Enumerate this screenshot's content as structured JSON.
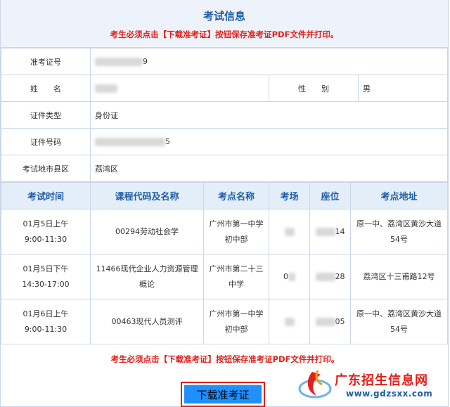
{
  "header": {
    "title": "考试信息",
    "notice": "考生必须点击【下载准考证】按钮保存准考证PDF文件并打印。"
  },
  "candidate": {
    "admission_no_label": "准考证号",
    "admission_no_suffix": "9",
    "name_label": "姓　　名",
    "gender_label": "性　　别",
    "gender_value": "男",
    "id_type_label": "证件类型",
    "id_type_value": "身份证",
    "id_no_label": "证件号码",
    "id_no_suffix": "5",
    "region_label": "考试地市县区",
    "region_value": "荔湾区"
  },
  "exam_table": {
    "headers": [
      "考试时间",
      "课程代码及名称",
      "考点名称",
      "考场",
      "座位",
      "考点地址"
    ],
    "rows": [
      {
        "date": "01月5日上午",
        "time": "9:00-11:30",
        "course": "00294劳动社会学",
        "site": "广州市第一中学初中部",
        "room": "",
        "seat_suffix": "14",
        "address": "原一中、荔湾区黄沙大道54号"
      },
      {
        "date": "01月5日下午",
        "time": "14:30-17:00",
        "course": "11466现代企业人力资源管理概论",
        "site": "广州市第二十三中学",
        "room": "0",
        "seat_suffix": "28",
        "address": "荔湾区十三甫路12号"
      },
      {
        "date": "01月6日上午",
        "time": "9:00-11:30",
        "course": "00463现代人员测评",
        "site": "广州市第一中学初中部",
        "room": "",
        "seat_suffix": "05",
        "address": "原一中、荔湾区黄沙大道54号"
      }
    ]
  },
  "footer": {
    "notice": "考生必须点击【下载准考证】按钮保存准考证PDF文件并打印。",
    "download_label": "下载准考证"
  },
  "watermark": {
    "brand": "广东招生信息网",
    "url": "www.gdzsxx.com"
  },
  "colors": {
    "title_blue": "#1e5da8",
    "notice_red": "#e0201a",
    "button_blue": "#1e90ff",
    "header_bg": "#eef3fb"
  }
}
